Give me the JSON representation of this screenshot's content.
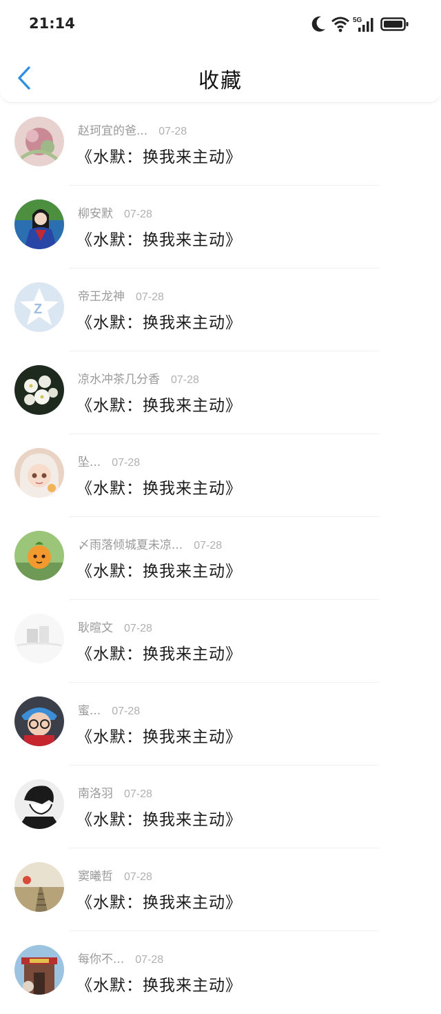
{
  "status": {
    "time": "21:14",
    "network": "5G"
  },
  "header": {
    "title": "收藏"
  },
  "items": [
    {
      "user": "赵珂宜的爸...",
      "date": "07-28",
      "work": "《水默：换我来主动》",
      "avatar": "pink-flower-art"
    },
    {
      "user": "柳安默",
      "date": "07-28",
      "work": "《水默：换我来主动》",
      "avatar": "woman-blue-costume"
    },
    {
      "user": "帝王龙神",
      "date": "07-28",
      "work": "《水默：换我来主动》",
      "avatar": "default-star-logo"
    },
    {
      "user": "凉水冲茶几分香",
      "date": "07-28",
      "work": "《水默：换我来主动》",
      "avatar": "white-flowers"
    },
    {
      "user": "坠...",
      "date": "07-28",
      "work": "《水默：换我来主动》",
      "avatar": "anime-girl"
    },
    {
      "user": "〆雨落倾城夏未凉...",
      "date": "07-28",
      "work": "《水默：换我来主动》",
      "avatar": "orange-character"
    },
    {
      "user": "耿暄文",
      "date": "07-28",
      "work": "《水默：换我来主动》",
      "avatar": "faded-landscape"
    },
    {
      "user": "蜜...",
      "date": "07-28",
      "work": "《水默：换我来主动》",
      "avatar": "bear-glasses"
    },
    {
      "user": "南洛羽",
      "date": "07-28",
      "work": "《水默：换我来主动》",
      "avatar": "bw-sketch"
    },
    {
      "user": "窦曦哲",
      "date": "07-28",
      "work": "《水默：换我来主动》",
      "avatar": "railway-path"
    },
    {
      "user": "每你不...",
      "date": "07-28",
      "work": "《水默：换我来主动》",
      "avatar": "red-gate"
    }
  ],
  "colors": {
    "accent": "#2f8fe0",
    "muted": "#9a9a9a"
  }
}
